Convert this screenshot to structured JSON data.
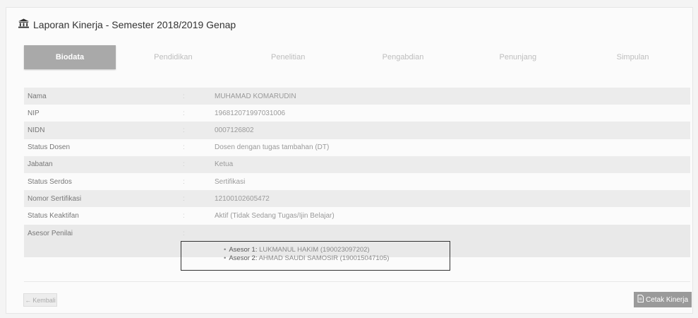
{
  "page": {
    "title": "Laporan Kinerja - Semester 2018/2019 Genap"
  },
  "tabs": [
    {
      "label": "Biodata",
      "active": true
    },
    {
      "label": "Pendidikan",
      "active": false
    },
    {
      "label": "Penelitian",
      "active": false
    },
    {
      "label": "Pengabdian",
      "active": false
    },
    {
      "label": "Penunjang",
      "active": false
    },
    {
      "label": "Simpulan",
      "active": false
    }
  ],
  "biodata": [
    {
      "label": "Nama",
      "sep": ":",
      "value": "MUHAMAD KOMARUDIN"
    },
    {
      "label": "NIP",
      "sep": ":",
      "value": "196812071997031006"
    },
    {
      "label": "NIDN",
      "sep": ":",
      "value": "0007126802"
    },
    {
      "label": "Status Dosen",
      "sep": ":",
      "value": "Dosen dengan tugas tambahan (DT)"
    },
    {
      "label": "Jabatan",
      "sep": ":",
      "value": "Ketua"
    },
    {
      "label": "Status Serdos",
      "sep": ":",
      "value": "Sertifikasi"
    },
    {
      "label": "Nomor Sertifikasi",
      "sep": ":",
      "value": "12100102605472"
    },
    {
      "label": "Status Keaktifan",
      "sep": ":",
      "value": "Aktif (Tidak Sedang Tugas/Ijin Belajar)"
    }
  ],
  "asesor": {
    "label": "Asesor Penilai",
    "sep": ":",
    "items": [
      {
        "key": "Asesor 1:",
        "value": "LUKMANUL HAKIM (190023097202)"
      },
      {
        "key": "Asesor 2:",
        "value": "AHMAD SAUDI SAMOSIR (190015047105)"
      }
    ]
  },
  "footer": {
    "back_label": "Kembali",
    "print_label": "Cetak Kinerja"
  },
  "icons": {
    "title": "institution-icon",
    "back": "arrow-left-icon",
    "print": "document-icon"
  }
}
